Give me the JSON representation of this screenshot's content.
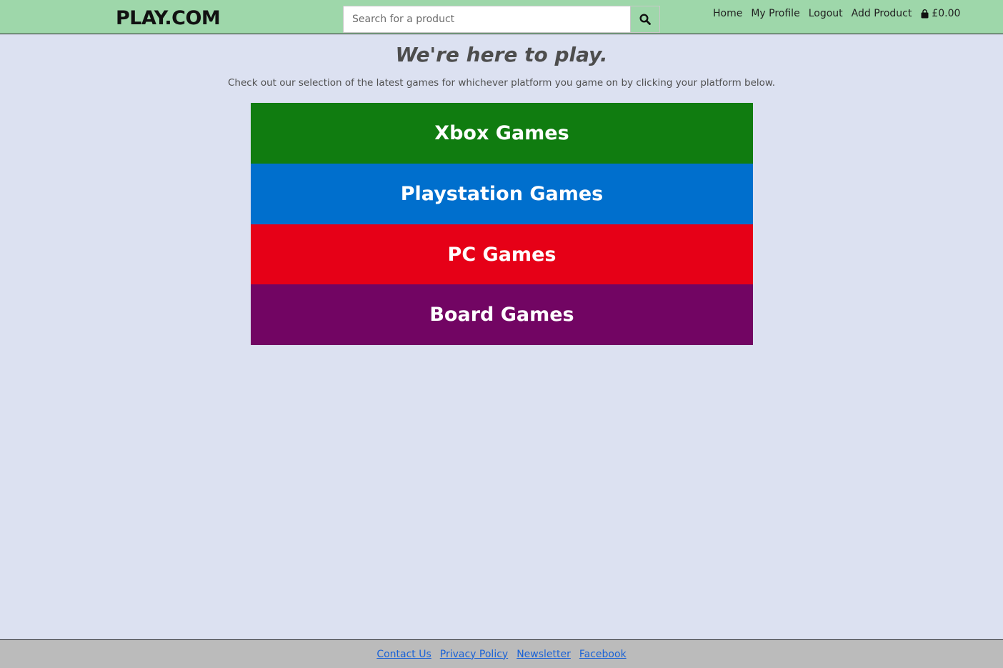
{
  "header": {
    "logo": "PLAY.COM",
    "search": {
      "placeholder": "Search for a product",
      "value": "",
      "icon": "search-icon"
    },
    "nav": {
      "home": "Home",
      "profile": "My Profile",
      "logout": "Logout",
      "add_product": "Add Product"
    },
    "cart": {
      "icon": "shopping-bag-icon",
      "total": "£0.00"
    }
  },
  "main": {
    "title": "We're here to play.",
    "subtitle": "Check out our selection of the latest games for whichever platform you game on by clicking your platform below.",
    "platforms": [
      {
        "label": "Xbox Games",
        "color": "#107c10"
      },
      {
        "label": "Playstation Games",
        "color": "#006fcd"
      },
      {
        "label": "PC Games",
        "color": "#e60017"
      },
      {
        "label": "Board Games",
        "color": "#720563"
      }
    ]
  },
  "footer": {
    "links": [
      "Contact Us",
      "Privacy Policy",
      "Newsletter",
      "Facebook"
    ]
  },
  "colors": {
    "header_bg": "#9ed7aa",
    "page_bg": "#dce1f1",
    "footer_bg": "#bbbbbb",
    "link": "#1a62d6"
  }
}
